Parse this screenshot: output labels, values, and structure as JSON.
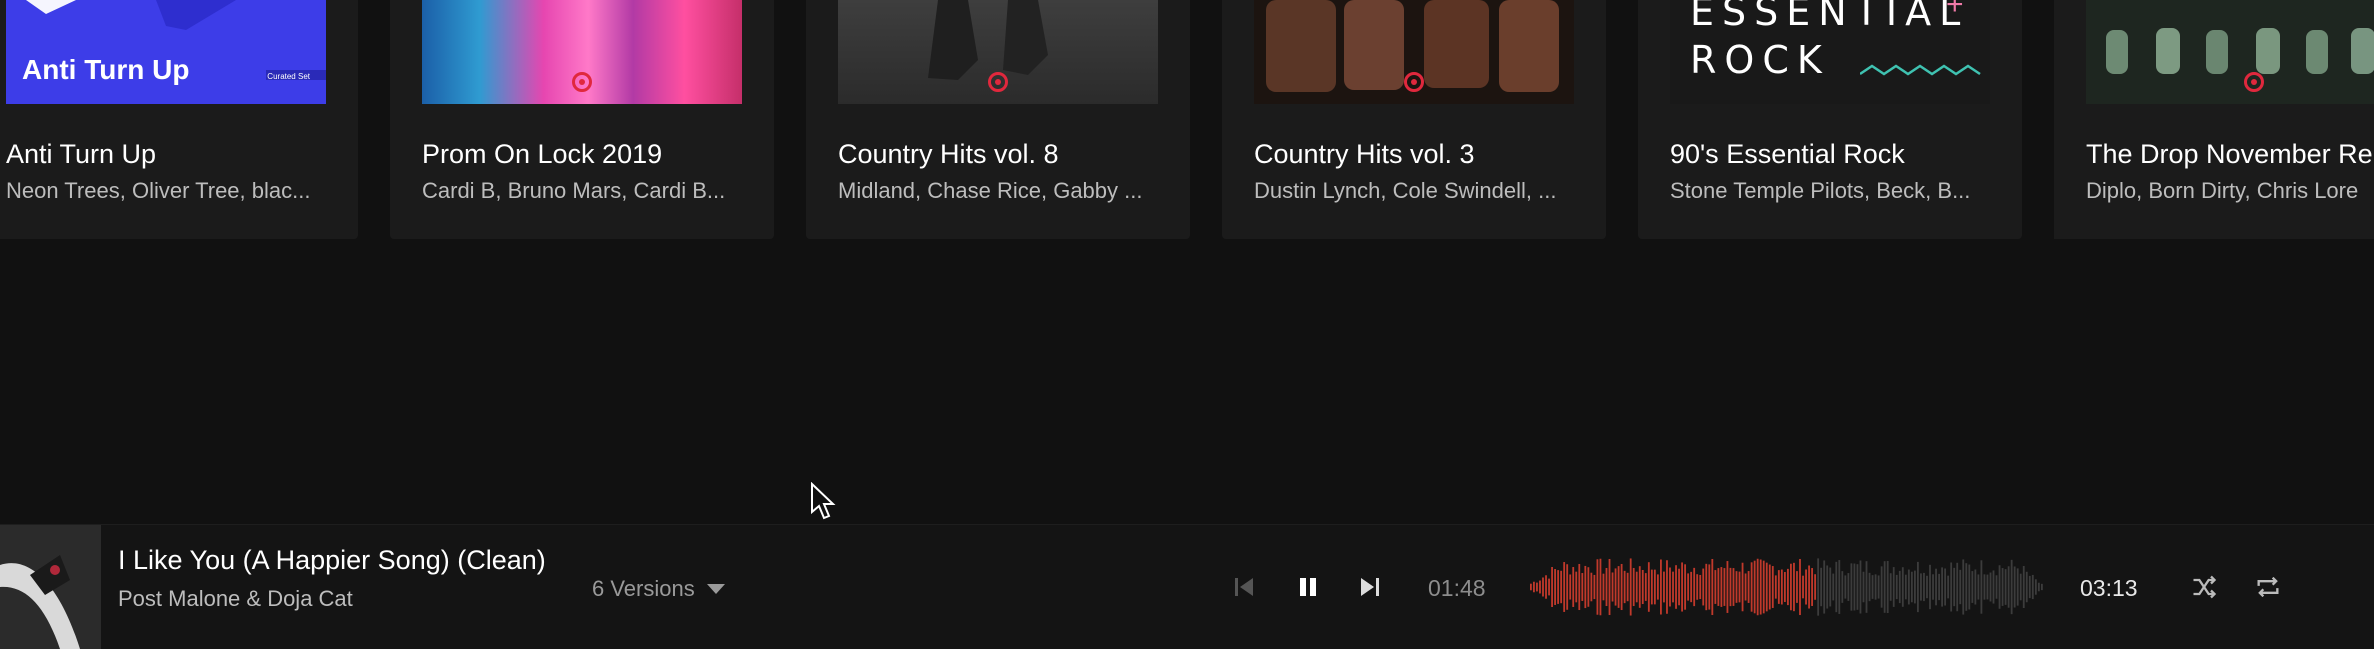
{
  "cards": [
    {
      "title": "Anti Turn Up",
      "subtitle": "Neon Trees, Oliver Tree, blac...",
      "art_text": "Anti Turn Up",
      "art_tag": "Curated Set"
    },
    {
      "title": "Prom On Lock 2019",
      "subtitle": "Cardi B, Bruno Mars, Cardi B..."
    },
    {
      "title": "Country Hits vol. 8",
      "subtitle": "Midland, Chase Rice, Gabby ..."
    },
    {
      "title": "Country Hits vol. 3",
      "subtitle": "Dustin Lynch, Cole Swindell, ..."
    },
    {
      "title": "90's Essential Rock",
      "subtitle": "Stone Temple Pilots, Beck, B...",
      "art_line1": "ESSENTIAL",
      "art_line2": "ROCK"
    },
    {
      "title": "The Drop November Re",
      "subtitle": "Diplo, Born Dirty, Chris Lore"
    }
  ],
  "player": {
    "track_title": "I Like You (A Happier Song) (Clean)",
    "artist": "Post Malone & Doja Cat",
    "versions_label": "6 Versions",
    "elapsed": "01:48",
    "duration": "03:13",
    "progress": 0.56
  },
  "colors": {
    "accent": "#c0392b",
    "background": "#111111",
    "card": "#1b1b1b"
  }
}
